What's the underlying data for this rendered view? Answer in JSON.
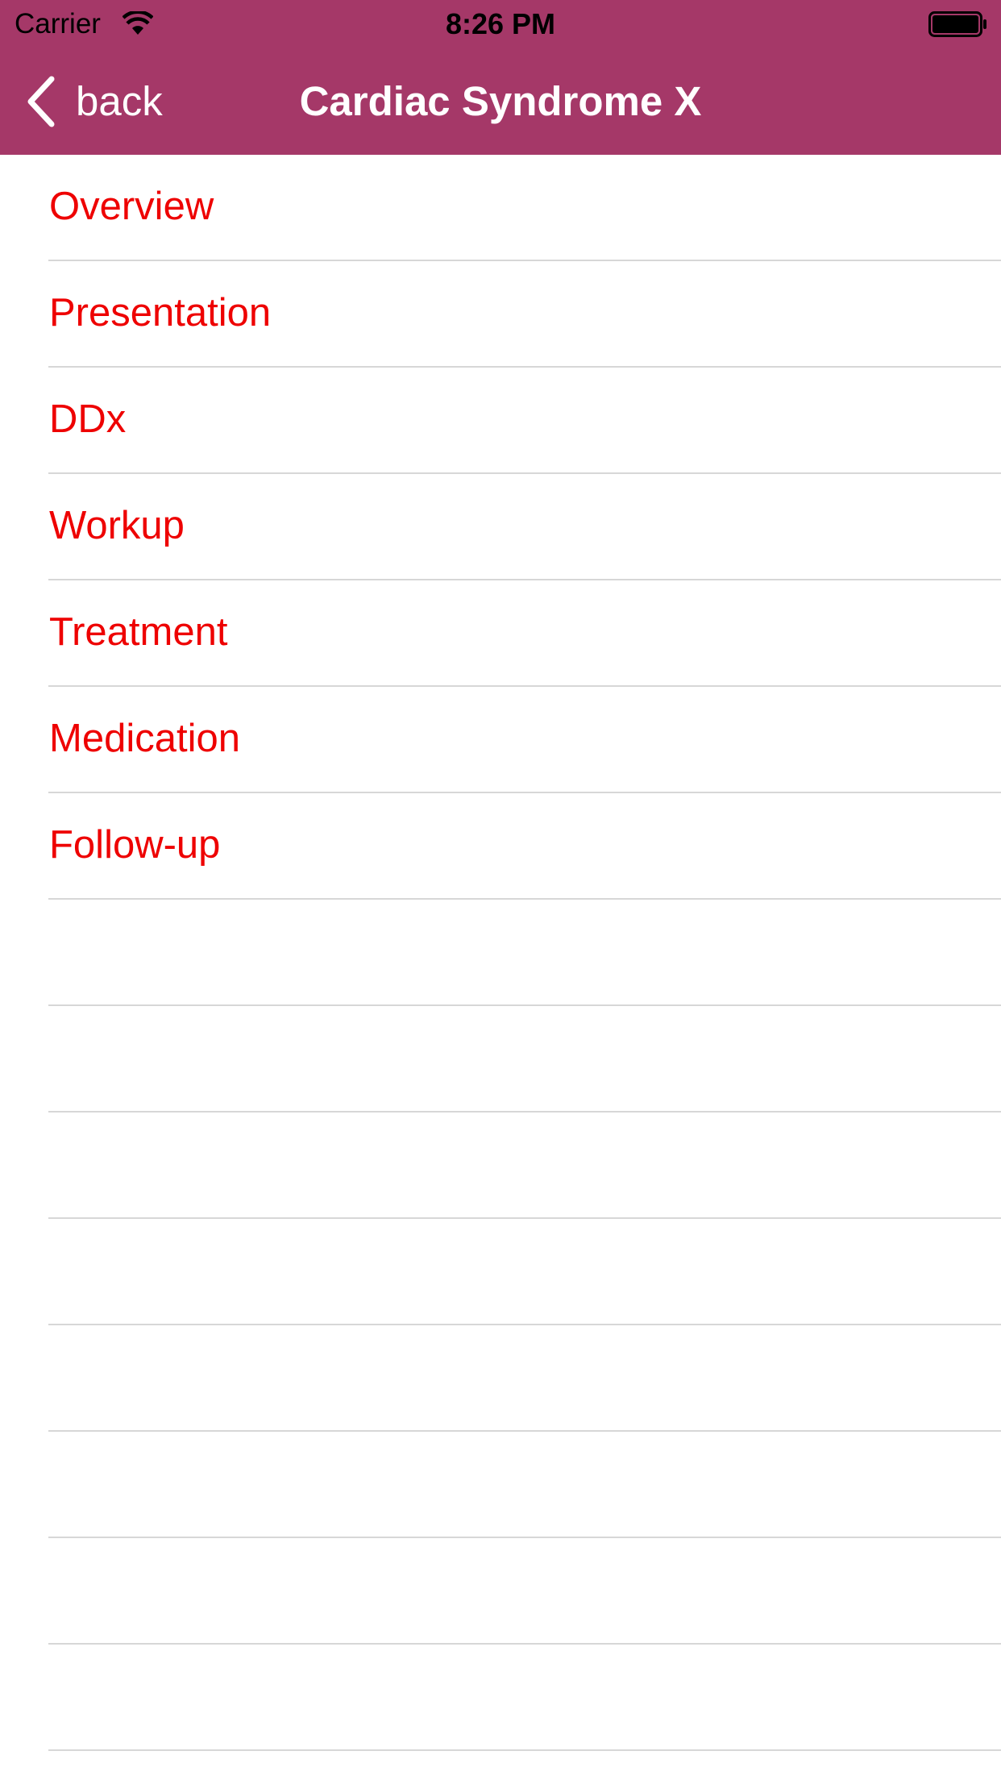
{
  "status_bar": {
    "carrier": "Carrier",
    "time": "8:26 PM"
  },
  "nav": {
    "back_label": "back",
    "title": "Cardiac Syndrome X"
  },
  "menu_items": [
    "Overview",
    "Presentation",
    "DDx",
    "Workup",
    "Treatment",
    "Medication",
    "Follow-up"
  ],
  "colors": {
    "header_bg": "#a53868",
    "item_text": "#ee0000",
    "separator": "#d7d7d7"
  },
  "icons": {
    "back": "chevron-left-icon",
    "wifi": "wifi-icon",
    "battery": "battery-icon"
  }
}
